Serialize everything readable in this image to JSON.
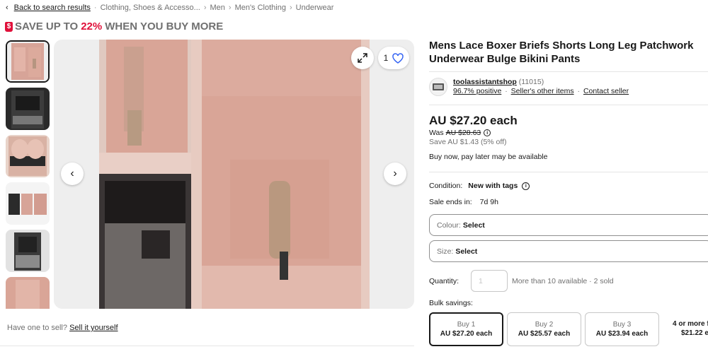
{
  "breadcrumb": {
    "back": "Back to search results",
    "crumbs": [
      "Clothing, Shoes & Accesso...",
      "Men",
      "Men's Clothing",
      "Underwear"
    ]
  },
  "promo": {
    "prefix": "SAVE UP TO",
    "percent": "22%",
    "suffix": "WHEN YOU BUY MORE",
    "icon": "tag-icon"
  },
  "gallery": {
    "watch_count": "1",
    "thumb_count": 6,
    "active_thumb": 1
  },
  "sell_prompt": {
    "text": "Have one to sell?",
    "link": "Sell it yourself"
  },
  "item": {
    "title": "Mens Lace Boxer Briefs Shorts Long Leg Patchwork Underwear Bulge Bikini Pants"
  },
  "seller": {
    "name": "toolassistantshop",
    "count": "(11015)",
    "positive": "96.7% positive",
    "other_items": "Seller's other items",
    "contact": "Contact seller"
  },
  "pricing": {
    "price": "AU $27.20 each",
    "was_label": "Was",
    "was_price": "AU $28.63",
    "save": "Save AU $1.43 (5% off)",
    "bnpl": "Buy now, pay later may be available"
  },
  "details": {
    "condition_label": "Condition:",
    "condition_value": "New with tags",
    "sale_label": "Sale ends in:",
    "sale_value": "7d 9h"
  },
  "options": {
    "colour_label": "Colour:",
    "colour_value": "Select",
    "size_label": "Size:",
    "size_value": "Select"
  },
  "quantity": {
    "label": "Quantity:",
    "placeholder": "1",
    "availability": "More than 10 available · 2 sold"
  },
  "bulk": {
    "label": "Bulk savings:",
    "tiers": [
      {
        "title": "Buy 1",
        "price": "AU $27.20 each"
      },
      {
        "title": "Buy 2",
        "price": "AU $25.57 each"
      },
      {
        "title": "Buy 3",
        "price": "AU $23.94 each"
      },
      {
        "title": "4 or more f",
        "price": "$21.22 e"
      }
    ]
  },
  "colors": {
    "accent_red": "#e0103a",
    "text": "#191919",
    "muted": "#707070",
    "photo_pink": "#d9a597"
  }
}
